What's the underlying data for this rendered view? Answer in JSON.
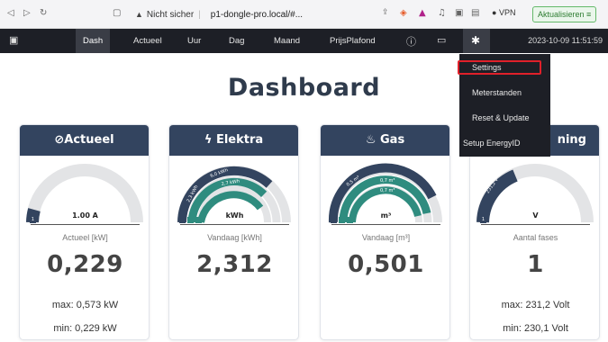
{
  "browser": {
    "security_warning": "Nicht sicher",
    "url": "p1-dongle-pro.local/#...",
    "vpn_label": "VPN",
    "update_button": "Aktualisieren"
  },
  "nav": {
    "items": [
      "Dash",
      "Actueel",
      "Uur",
      "Dag",
      "Maand",
      "PrijsPlafond"
    ],
    "active": "Dash",
    "datetime": "2023-10-09 11:51:59"
  },
  "dropdown": {
    "items": [
      "Settings",
      "Meterstanden",
      "Reset & Update",
      "Setup EnergyID"
    ],
    "highlighted": "Settings"
  },
  "page": {
    "title": "Dashboard"
  },
  "cards": [
    {
      "title": "Actueel",
      "gauge_value": "1.00 A",
      "sub_label": "Actueel [kW]",
      "value": "0,229",
      "max": "max: 0,573 kW",
      "min": "min: 0,229 kW",
      "icon": "gauge-icon"
    },
    {
      "title": "Elektra",
      "gauge_value": "kWh",
      "sub_label": "Vandaag [kWh]",
      "value": "2,312",
      "icon": "bolt-icon",
      "arc_labels": [
        "2,3 kWh",
        "6,0 kWh",
        "2,7 kWh"
      ]
    },
    {
      "title": "Gas",
      "gauge_value": "m³",
      "sub_label": "Vandaag [m³]",
      "value": "0,501",
      "icon": "flame-icon",
      "arc_labels": [
        "0,5 m³",
        "0,7 m³",
        "0,7 m³"
      ]
    },
    {
      "title": "Spanning",
      "title_visible": "ning",
      "gauge_value": "V",
      "sub_label": "Aantal fases",
      "value": "1",
      "max": "max: 231,2 Volt",
      "min": "min: 230,1 Volt",
      "icon": "",
      "arc_labels": [
        "231,2 V"
      ]
    }
  ],
  "colors": {
    "navbar": "#1d1f26",
    "card_header": "#33445f",
    "accent_green": "#2f8c7f",
    "highlight_red": "#e0202a"
  }
}
